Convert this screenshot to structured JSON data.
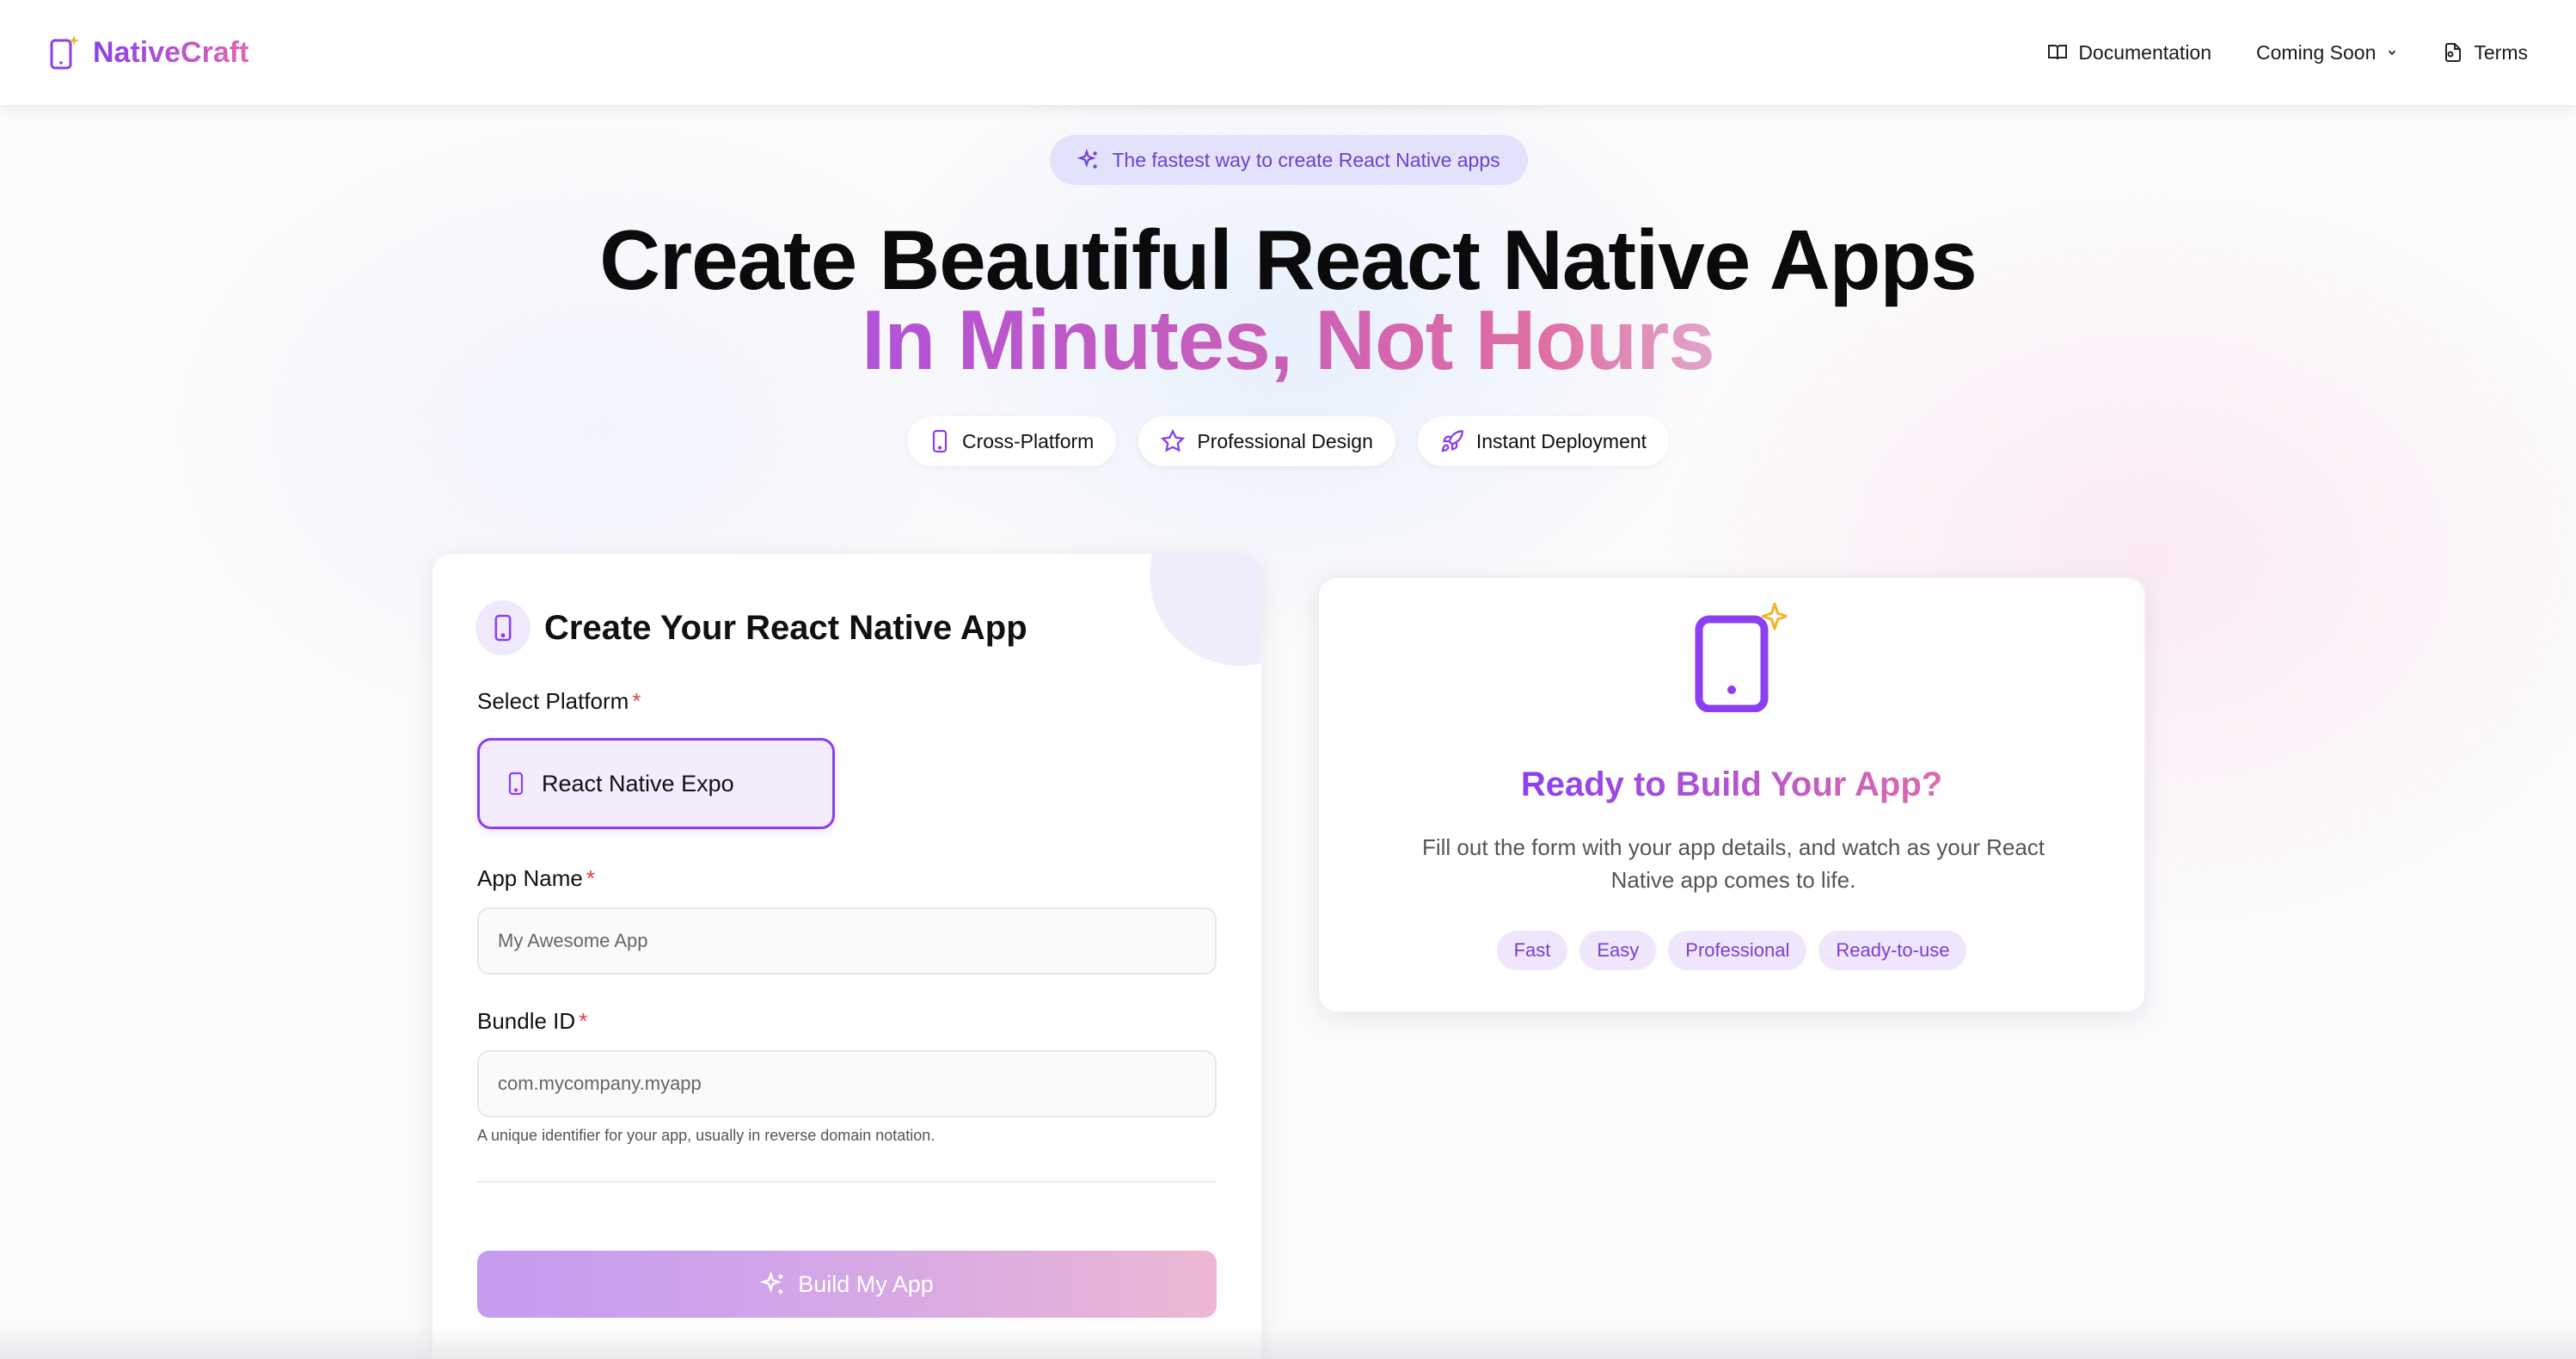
{
  "navbar": {
    "brand": "NativeCraft",
    "links": {
      "documentation": "Documentation",
      "coming_soon": "Coming Soon",
      "terms": "Terms"
    }
  },
  "hero": {
    "pill": "The fastest way to create React Native apps",
    "title_line1": "Create Beautiful React Native Apps",
    "title_line2": "In Minutes, Not Hours",
    "chips": {
      "cross_platform": "Cross-Platform",
      "professional_design": "Professional Design",
      "instant_deployment": "Instant Deployment"
    }
  },
  "form": {
    "title": "Create Your React Native App",
    "platform_label": "Select Platform",
    "platform_option": "React Native Expo",
    "app_name_label": "App Name",
    "app_name_placeholder": "My Awesome App",
    "bundle_id_label": "Bundle ID",
    "bundle_id_placeholder": "com.mycompany.myapp",
    "bundle_id_helper": "A unique identifier for your app, usually in reverse domain notation.",
    "required_marker": "*",
    "build_button": "Build My App"
  },
  "preview": {
    "title": "Ready to Build Your App?",
    "text": "Fill out the form with your app details, and watch as your React Native app comes to life.",
    "tags": [
      "Fast",
      "Easy",
      "Professional",
      "Ready-to-use"
    ]
  },
  "colors": {
    "accent_purple": "#8b3ff0",
    "accent_pink": "#e067b3",
    "sparkle_yellow": "#f0b429",
    "required_red": "#e0413b"
  }
}
